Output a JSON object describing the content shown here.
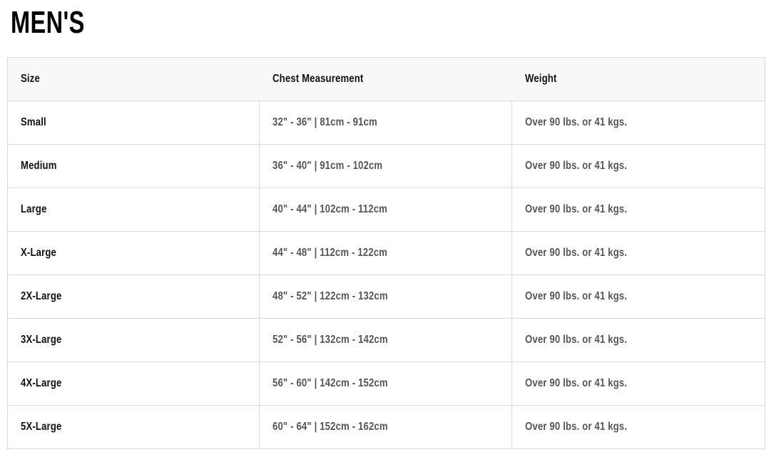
{
  "page": {
    "title": "MEN'S"
  },
  "table": {
    "headers": [
      "Size",
      "Chest Measurement",
      "Weight"
    ],
    "rows": [
      [
        "Small",
        "32\" - 36\" | 81cm - 91cm",
        "Over 90 lbs. or 41 kgs."
      ],
      [
        "Medium",
        "36\" - 40\" | 91cm - 102cm",
        "Over 90 lbs. or 41 kgs."
      ],
      [
        "Large",
        "40\" - 44\" | 102cm - 112cm",
        "Over 90 lbs. or 41 kgs."
      ],
      [
        "X-Large",
        "44\" - 48\" | 112cm - 122cm",
        "Over 90 lbs. or 41 kgs."
      ],
      [
        "2X-Large",
        "48\" - 52\" | 122cm - 132cm",
        "Over 90 lbs. or 41 kgs."
      ],
      [
        "3X-Large",
        "52\" - 56\" | 132cm - 142cm",
        "Over 90 lbs. or 41 kgs."
      ],
      [
        "4X-Large",
        "56\" - 60\" | 142cm - 152cm",
        "Over 90 lbs. or 41 kgs."
      ],
      [
        "5X-Large",
        "60\" - 64\" | 152cm - 162cm",
        "Over 90 lbs. or 41 kgs."
      ]
    ]
  },
  "colors": {
    "header_background": "#f8f8f8",
    "border": "#d9d9d9",
    "size_text": "#111111",
    "value_text": "#555555"
  }
}
